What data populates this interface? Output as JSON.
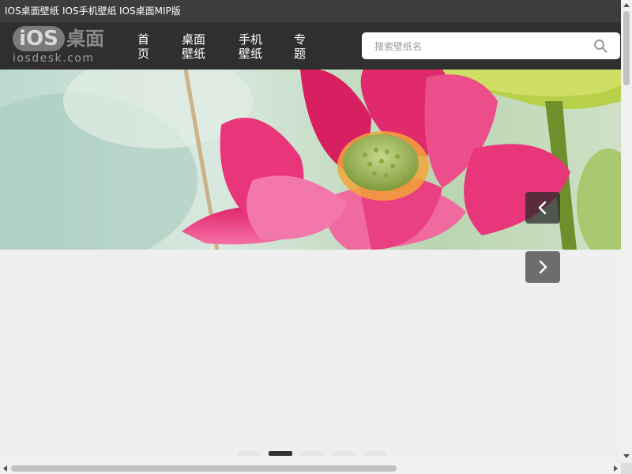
{
  "topbar": {
    "links": [
      {
        "label": "IOS桌面壁纸"
      },
      {
        "label": "IOS手机壁纸"
      },
      {
        "label": "IOS桌面MIP版"
      }
    ]
  },
  "logo": {
    "ios_text": "iOS",
    "cn_text": "桌面",
    "domain": "iosdesk.com"
  },
  "nav": {
    "items": [
      {
        "label": "首页"
      },
      {
        "label": "桌面壁纸"
      },
      {
        "label": "手机壁纸"
      },
      {
        "label": "专题"
      }
    ]
  },
  "search": {
    "placeholder": "搜索壁纸名",
    "value": ""
  },
  "banner": {
    "prev_icon": "chevron-left-icon",
    "next_icon": "chevron-right-icon"
  },
  "carousel": {
    "slide_count": 5,
    "active_index": 1
  },
  "colors": {
    "topbar_bg": "#3d3d3d",
    "navbar_bg": "#2f2f2f",
    "page_bg": "#efefef",
    "dot_active": "#333333",
    "dot_inactive": "#e6e6e6"
  }
}
